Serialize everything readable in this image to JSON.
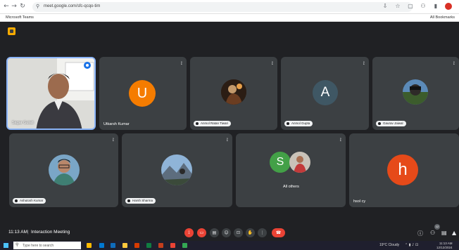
{
  "browser": {
    "url": "meet.google.com/sfc-qcqo-tim",
    "bookmark": "Microsoft Teams",
    "bookmark_right": "All Bookmarks"
  },
  "meeting": {
    "time": "11:13 AM",
    "separator": "|",
    "name": "Interaction Meeting",
    "people_count": "12"
  },
  "participants": [
    {
      "name": "Sagar Gulati",
      "type": "video"
    },
    {
      "name": "Utkarsh Kumar",
      "type": "letter",
      "letter": "U",
      "color": "#f57c00"
    },
    {
      "name": "Anmol Ratan Tiwari",
      "type": "photo"
    },
    {
      "name": "Anmol Gupta",
      "type": "letter",
      "letter": "A",
      "color": "#3f5764"
    },
    {
      "name": "Gaurav Jaiwal",
      "type": "photo"
    },
    {
      "name": "Ashutosh Kumar",
      "type": "photo"
    },
    {
      "name": "Harsh Sharma",
      "type": "photo"
    },
    {
      "name": "All others",
      "type": "group",
      "letter": "S",
      "color": "#43a047"
    },
    {
      "name": "hsol cy",
      "type": "letter",
      "letter": "h",
      "color": "#e64a19"
    }
  ],
  "taskbar": {
    "search_placeholder": "Type here to search",
    "weather": "19°C Cloudy",
    "time": "11:13 AM",
    "date": "12/12/2024"
  },
  "icons": {
    "mic": "mic-off-icon",
    "camera": "camera-off-icon",
    "captions": "captions-icon",
    "emoji": "emoji-icon",
    "present": "present-icon",
    "raise_hand": "raise-hand-icon",
    "more": "more-options-icon",
    "end": "end-call-icon",
    "info": "info-icon",
    "people": "people-icon",
    "chat": "chat-icon",
    "activities": "activities-icon"
  }
}
